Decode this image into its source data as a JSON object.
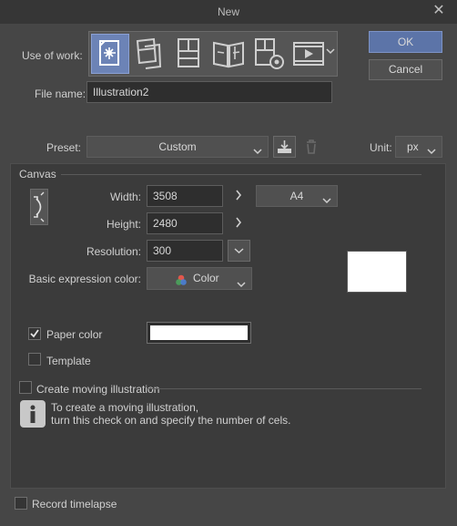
{
  "window": {
    "title": "New"
  },
  "buttons": {
    "ok": "OK",
    "cancel": "Cancel"
  },
  "use_of_work": {
    "label": "Use of work:"
  },
  "file_name": {
    "label": "File name:",
    "value": "Illustration2"
  },
  "preset": {
    "label": "Preset:",
    "value": "Custom"
  },
  "unit": {
    "label": "Unit:",
    "value": "px"
  },
  "canvas": {
    "section_label": "Canvas",
    "width_label": "Width:",
    "width_value": "3508",
    "height_label": "Height:",
    "height_value": "2480",
    "paper_size": "A4",
    "resolution_label": "Resolution:",
    "resolution_value": "300",
    "expression_label": "Basic expression color:",
    "expression_value": "Color",
    "paper_color_label": "Paper color",
    "paper_color_checked": true,
    "template_label": "Template",
    "template_checked": false
  },
  "moving": {
    "checkbox_label": "Create moving illustration",
    "info_line1": "To create a moving illustration,",
    "info_line2": "turn this check on and specify the number of cels."
  },
  "timelapse": {
    "label": "Record timelapse"
  },
  "colors": {
    "accent": "#6c83b6",
    "background": "#464646",
    "field": "#2e2e2e",
    "paper": "#ffffff"
  },
  "icons": [
    "illustration-icon",
    "webtoon-icon",
    "comic-icon",
    "book-icon",
    "comic-settings-icon",
    "animation-icon",
    "color-wheel-icon",
    "info-icon",
    "save-preset-icon",
    "delete-preset-icon",
    "swap-orientation-icon"
  ]
}
